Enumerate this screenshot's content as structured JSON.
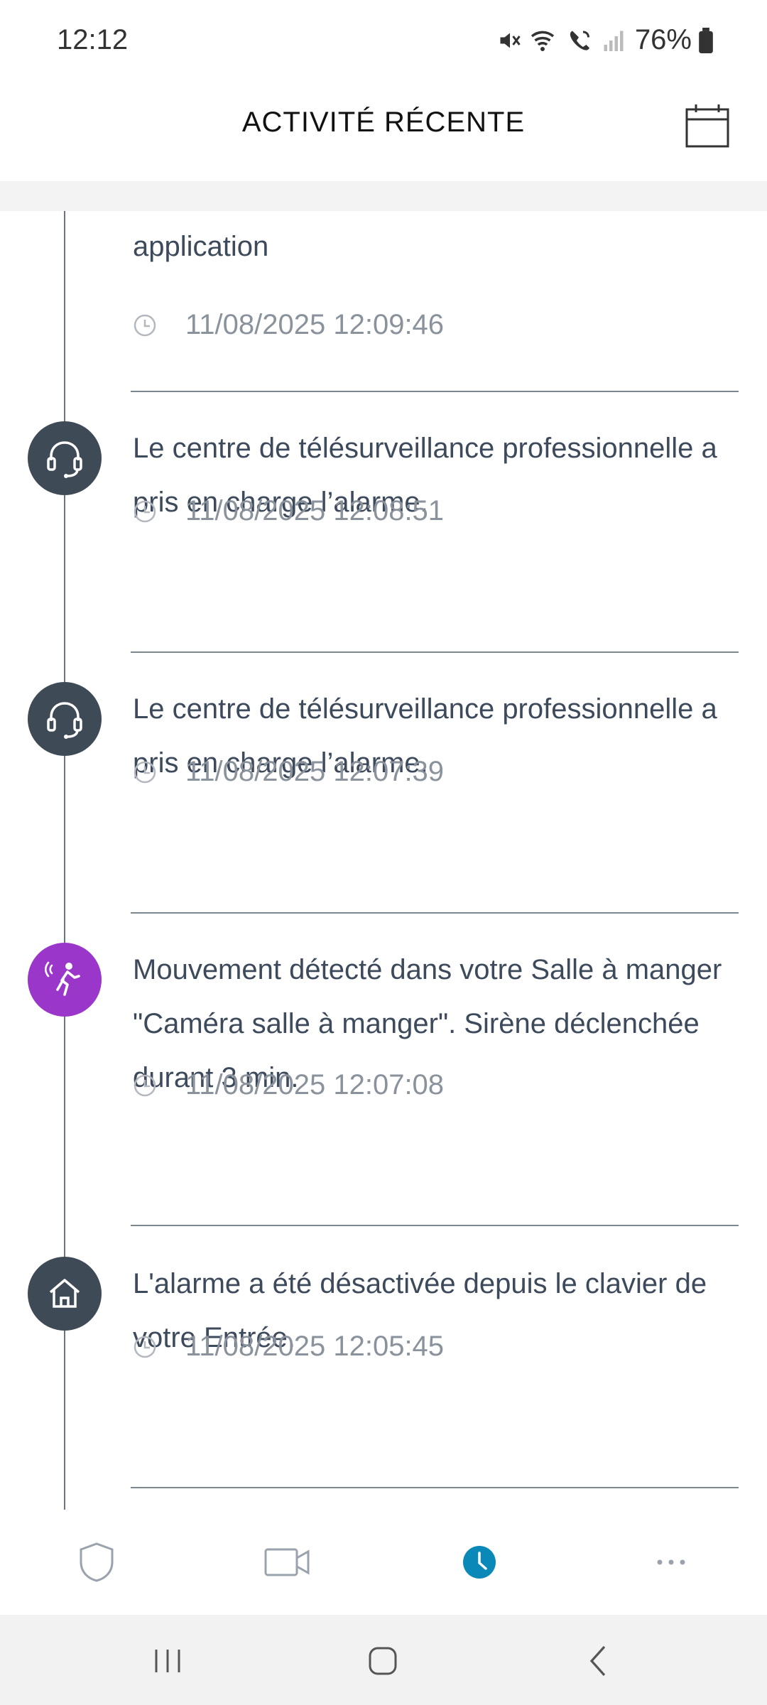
{
  "status_bar": {
    "time": "12:12",
    "battery": "76%"
  },
  "header": {
    "title": "ACTIVITÉ RÉCENTE"
  },
  "events": [
    {
      "icon": "none",
      "text": "application",
      "timestamp": "11/08/2025 12:09:46"
    },
    {
      "icon": "headset-icon",
      "text": "Le centre de télésurveillance professionnelle a pris en charge l’alarme.",
      "timestamp": "11/08/2025 12:08:51"
    },
    {
      "icon": "headset-icon",
      "text": "Le centre de télésurveillance professionnelle a pris en charge l’alarme.",
      "timestamp": "11/08/2025 12:07:39"
    },
    {
      "icon": "motion-detected-icon",
      "text": "Mouvement détecté dans votre Salle à manger \"Caméra salle à manger\". Sirène déclenchée durant 3 min.",
      "timestamp": "11/08/2025 12:07:08"
    },
    {
      "icon": "home-icon",
      "text": "L'alarme a été désactivée depuis le clavier de votre Entrée.",
      "timestamp": "11/08/2025 12:05:45"
    }
  ],
  "bottom_nav": {
    "items": [
      "shield-icon",
      "camera-icon",
      "clock-icon",
      "more-icon"
    ],
    "active": "clock-icon"
  },
  "colors": {
    "accent": "#0a88b8",
    "icon_dark": "#3f4a57",
    "motion_purple": "#9a36c9",
    "text": "#3d4a5c",
    "timestamp": "#8a929c"
  }
}
